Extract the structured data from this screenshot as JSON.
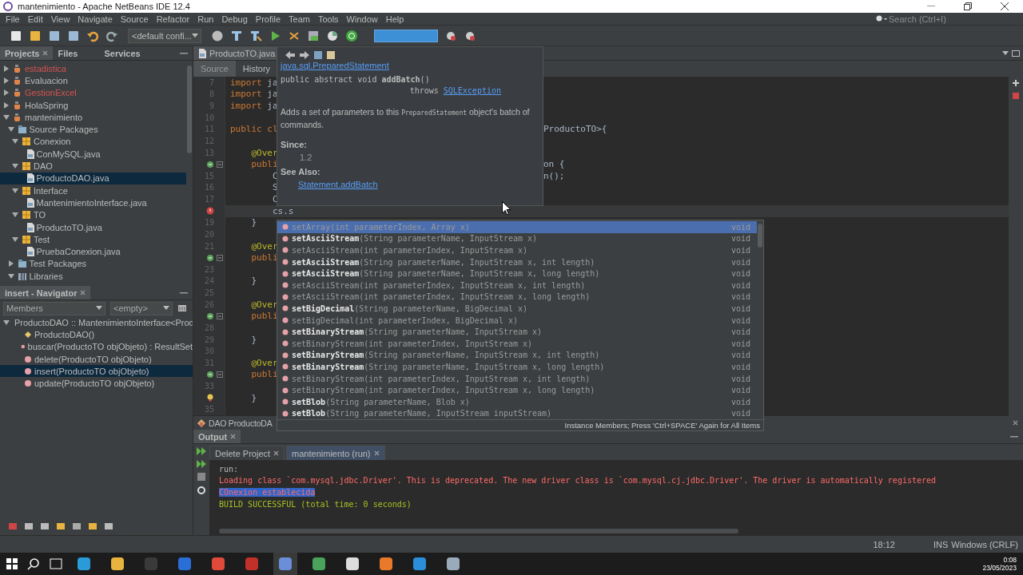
{
  "window": {
    "title": "mantenimiento - Apache NetBeans IDE 12.4"
  },
  "menu": [
    "File",
    "Edit",
    "View",
    "Navigate",
    "Source",
    "Refactor",
    "Run",
    "Debug",
    "Profile",
    "Team",
    "Tools",
    "Window",
    "Help"
  ],
  "search": {
    "placeholder": "Search (Ctrl+I)"
  },
  "toolbar": {
    "config": "<default confi..."
  },
  "projects_panel": {
    "tabs": [
      {
        "label": "Projects",
        "selected": true
      },
      {
        "label": "Files",
        "selected": false
      },
      {
        "label": "Services",
        "selected": false
      }
    ],
    "tree": [
      {
        "label": "estadistica",
        "kind": "project",
        "expanded": false,
        "selected": false,
        "error": true
      },
      {
        "label": "Evaluacion",
        "kind": "project",
        "expanded": false,
        "selected": false,
        "error": false
      },
      {
        "label": "GestionExcel",
        "kind": "project",
        "expanded": false,
        "selected": false,
        "error": true
      },
      {
        "label": "HolaSpring",
        "kind": "project",
        "expanded": false,
        "selected": false,
        "error": false
      },
      {
        "label": "mantenimiento",
        "kind": "project",
        "expanded": true,
        "selected": false,
        "error": false,
        "children": [
          {
            "label": "Source Packages",
            "kind": "sources",
            "expanded": true,
            "selected": false,
            "children": [
              {
                "label": "Conexion",
                "kind": "package",
                "expanded": true,
                "selected": false,
                "children": [
                  {
                    "label": "ConMySQL.java",
                    "kind": "file",
                    "selected": false
                  }
                ]
              },
              {
                "label": "DAO",
                "kind": "package",
                "expanded": true,
                "selected": false,
                "children": [
                  {
                    "label": "ProductoDAO.java",
                    "kind": "file",
                    "selected": true
                  }
                ]
              },
              {
                "label": "Interface",
                "kind": "package",
                "expanded": true,
                "selected": false,
                "children": [
                  {
                    "label": "MantenimientoInterface.java",
                    "kind": "file",
                    "selected": false
                  }
                ]
              },
              {
                "label": "TO",
                "kind": "package",
                "expanded": true,
                "selected": false,
                "children": [
                  {
                    "label": "ProductoTO.java",
                    "kind": "file",
                    "selected": false
                  }
                ]
              },
              {
                "label": "Test",
                "kind": "package",
                "expanded": true,
                "selected": false,
                "children": [
                  {
                    "label": "PruebaConexion.java",
                    "kind": "file",
                    "selected": false
                  }
                ]
              }
            ]
          },
          {
            "label": "Test Packages",
            "kind": "sources",
            "expanded": false,
            "selected": false
          },
          {
            "label": "Libraries",
            "kind": "library",
            "expanded": true,
            "selected": false
          }
        ]
      }
    ]
  },
  "navigator": {
    "title": "insert - Navigator",
    "filter": "Members",
    "scope": "<empty>",
    "tree": [
      {
        "label": "ProductoDAO :: MantenimientoInterface<Prod",
        "kind": "class",
        "expanded": true,
        "selected": false,
        "children": [
          {
            "label": "ProductoDAO()",
            "kind": "constructor",
            "selected": false
          },
          {
            "label": "buscar(ProductoTO objObjeto) : ResultSet",
            "kind": "method",
            "selected": false
          },
          {
            "label": "delete(ProductoTO objObjeto)",
            "kind": "method",
            "selected": false
          },
          {
            "label": "insert(ProductoTO objObjeto)",
            "kind": "method",
            "selected": true
          },
          {
            "label": "update(ProductoTO objObjeto)",
            "kind": "method",
            "selected": false
          }
        ]
      }
    ]
  },
  "editor": {
    "tabs": [
      {
        "label": "ProductoTO.java",
        "selected": true
      }
    ],
    "views": [
      {
        "label": "Source",
        "selected": true
      },
      {
        "label": "History",
        "selected": false
      }
    ],
    "lines": [
      {
        "kind": "numbered",
        "number": "7",
        "current": false,
        "tokens": [
          {
            "text": "import",
            "kind": "keyword"
          },
          {
            "text": " ja",
            "kind": "plain"
          }
        ]
      },
      {
        "kind": "numbered",
        "number": "8",
        "current": false,
        "tokens": [
          {
            "text": "import",
            "kind": "keyword"
          },
          {
            "text": " ja",
            "kind": "plain"
          }
        ]
      },
      {
        "kind": "numbered",
        "number": "9",
        "current": false,
        "tokens": [
          {
            "text": "import",
            "kind": "keyword"
          },
          {
            "text": " ja",
            "kind": "plain"
          }
        ]
      },
      {
        "kind": "numbered",
        "number": "10",
        "current": false
      },
      {
        "kind": "numbered",
        "number": "11",
        "current": false,
        "tokens": [
          {
            "text": "public",
            "kind": "keyword"
          },
          {
            "text": " cl",
            "kind": "keyword"
          }
        ],
        "right": "ProductoTO>{"
      },
      {
        "kind": "numbered",
        "number": "12",
        "current": false
      },
      {
        "kind": "numbered",
        "number": "13",
        "current": false,
        "tokens": [
          {
            "text": "    @Over",
            "kind": "annotation"
          }
        ]
      },
      {
        "kind": "override",
        "fold": true,
        "current": false,
        "tokens": [
          {
            "text": "    publi",
            "kind": "keyword"
          }
        ],
        "right": "on {"
      },
      {
        "kind": "numbered",
        "number": "15",
        "current": false,
        "tokens": [
          {
            "text": "        C",
            "kind": "plain"
          }
        ],
        "right": "n();"
      },
      {
        "kind": "numbered",
        "number": "16",
        "current": false,
        "tokens": [
          {
            "text": "        S",
            "kind": "plain"
          }
        ]
      },
      {
        "kind": "numbered",
        "number": "17",
        "current": false,
        "tokens": [
          {
            "text": "        C",
            "kind": "plain"
          }
        ]
      },
      {
        "kind": "error",
        "current": true,
        "tokens": [
          {
            "text": "        cs.s",
            "kind": "plain"
          }
        ]
      },
      {
        "kind": "numbered",
        "number": "19",
        "current": false,
        "tokens": [
          {
            "text": "    }",
            "kind": "plain"
          }
        ]
      },
      {
        "kind": "numbered",
        "number": "20",
        "current": false
      },
      {
        "kind": "numbered",
        "number": "21",
        "current": false,
        "tokens": [
          {
            "text": "    @Over",
            "kind": "annotation"
          }
        ]
      },
      {
        "kind": "override",
        "fold": true,
        "current": false,
        "tokens": [
          {
            "text": "    publi",
            "kind": "keyword"
          }
        ]
      },
      {
        "kind": "numbered",
        "number": "23",
        "current": false
      },
      {
        "kind": "numbered",
        "number": "24",
        "current": false,
        "tokens": [
          {
            "text": "    }",
            "kind": "plain"
          }
        ]
      },
      {
        "kind": "numbered",
        "number": "25",
        "current": false
      },
      {
        "kind": "numbered",
        "number": "26",
        "current": false,
        "tokens": [
          {
            "text": "    @Over",
            "kind": "annotation"
          }
        ]
      },
      {
        "kind": "override",
        "fold": true,
        "current": false,
        "tokens": [
          {
            "text": "    publi",
            "kind": "keyword"
          }
        ]
      },
      {
        "kind": "numbered",
        "number": "28",
        "current": false
      },
      {
        "kind": "numbered",
        "number": "29",
        "current": false,
        "tokens": [
          {
            "text": "    }",
            "kind": "plain"
          }
        ]
      },
      {
        "kind": "numbered",
        "number": "30",
        "current": false
      },
      {
        "kind": "numbered",
        "number": "31",
        "current": false,
        "tokens": [
          {
            "text": "    @Over",
            "kind": "annotation"
          }
        ]
      },
      {
        "kind": "override",
        "fold": true,
        "current": false,
        "tokens": [
          {
            "text": "    publi",
            "kind": "keyword"
          }
        ]
      },
      {
        "kind": "numbered",
        "number": "33",
        "current": false
      },
      {
        "kind": "hint",
        "current": false,
        "tokens": [
          {
            "text": "    }",
            "kind": "plain"
          }
        ]
      },
      {
        "kind": "numbered",
        "number": "35",
        "current": false
      }
    ],
    "breadcrumb": "DAO ProductoDA"
  },
  "javadoc": {
    "class_link": "java.sql.PreparedStatement",
    "signature": "public abstract void **addBatch**()",
    "throws": "throws",
    "exception_link": "SQLException",
    "description": {
      "before": "Adds a set of parameters to this ",
      "code": "PreparedStatement",
      "after": " object's batch of commands."
    },
    "since_label": "Since:",
    "since": "1.2",
    "see_also_label": "See Also:",
    "see_also_link": "Statement.addBatch"
  },
  "completion": {
    "items": [
      {
        "signature": "setArray(int parameterIndex, Array x)",
        "type": "void",
        "selected": true
      },
      {
        "signature": "**setAsciiStream**(String parameterName, InputStream x)",
        "type": "void",
        "selected": false
      },
      {
        "signature": "setAsciiStream(int parameterIndex, InputStream x)",
        "type": "void",
        "selected": false
      },
      {
        "signature": "**setAsciiStream**(String parameterName, InputStream x, int length)",
        "type": "void",
        "selected": false
      },
      {
        "signature": "**setAsciiStream**(String parameterName, InputStream x, long length)",
        "type": "void",
        "selected": false
      },
      {
        "signature": "setAsciiStream(int parameterIndex, InputStream x, int length)",
        "type": "void",
        "selected": false
      },
      {
        "signature": "setAsciiStream(int parameterIndex, InputStream x, long length)",
        "type": "void",
        "selected": false
      },
      {
        "signature": "**setBigDecimal**(String parameterName, BigDecimal x)",
        "type": "void",
        "selected": false
      },
      {
        "signature": "setBigDecimal(int parameterIndex, BigDecimal x)",
        "type": "void",
        "selected": false
      },
      {
        "signature": "**setBinaryStream**(String parameterName, InputStream x)",
        "type": "void",
        "selected": false
      },
      {
        "signature": "setBinaryStream(int parameterIndex, InputStream x)",
        "type": "void",
        "selected": false
      },
      {
        "signature": "**setBinaryStream**(String parameterName, InputStream x, int length)",
        "type": "void",
        "selected": false
      },
      {
        "signature": "**setBinaryStream**(String parameterName, InputStream x, long length)",
        "type": "void",
        "selected": false
      },
      {
        "signature": "setBinaryStream(int parameterIndex, InputStream x, int length)",
        "type": "void",
        "selected": false
      },
      {
        "signature": "setBinaryStream(int parameterIndex, InputStream x, long length)",
        "type": "void",
        "selected": false
      },
      {
        "signature": "**setBlob**(String parameterName, Blob x)",
        "type": "void",
        "selected": false
      },
      {
        "signature": "**setBlob**(String parameterName, InputStream inputStream)",
        "type": "void",
        "selected": false
      }
    ],
    "footer": "Instance Members; Press 'Ctrl+SPACE' Again for All Items"
  },
  "output": {
    "title": "Output",
    "tabs": [
      {
        "label": "Delete Project",
        "selected": false
      },
      {
        "label": "mantenimiento (run)",
        "selected": true
      }
    ],
    "lines": [
      {
        "text": "run:",
        "kind": "plain",
        "selected": false
      },
      {
        "text": "Loading class `com.mysql.jdbc.Driver'. This is deprecated. The new driver class is `com.mysql.cj.jdbc.Driver'. The driver is automatically registered",
        "kind": "error",
        "selected": false
      },
      {
        "text": "COnexion establecida",
        "kind": "error",
        "selected": true
      },
      {
        "text": "BUILD SUCCESSFUL (total time: 0 seconds)",
        "kind": "success",
        "selected": false
      }
    ]
  },
  "status_bar": {
    "position": "18:12",
    "mode": "INS",
    "line_ending": "Windows (CRLF)"
  },
  "taskbar": {
    "time": "0:08",
    "date": "23/05/2023"
  }
}
